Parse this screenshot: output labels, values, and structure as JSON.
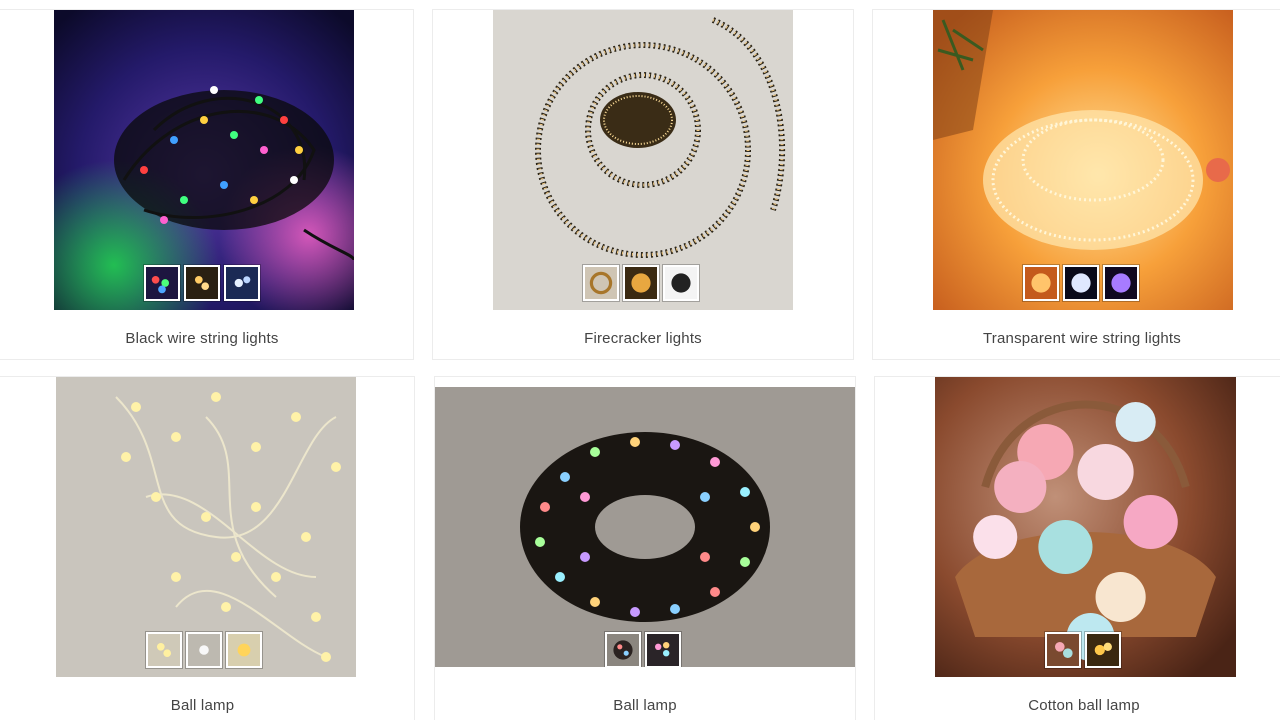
{
  "products": [
    {
      "title": "Black wire string lights",
      "image": "black-wire-string-lights-photo",
      "thumbnails": [
        "multicolor-lights-thumb",
        "warm-lights-thumb",
        "cool-white-lights-thumb"
      ]
    },
    {
      "title": "Firecracker lights",
      "image": "firecracker-lights-photo",
      "thumbnails": [
        "spiral-lights-thumb",
        "warm-cluster-thumb",
        "dark-cluster-thumb"
      ]
    },
    {
      "title": "Transparent wire string lights",
      "image": "transparent-wire-lights-photo",
      "thumbnails": [
        "amber-lights-thumb",
        "white-lights-thumb",
        "purple-lights-thumb"
      ]
    },
    {
      "title": "Ball lamp",
      "image": "yellow-ball-lamp-photo",
      "thumbnails": [
        "yellow-balls-thumb",
        "white-balls-thumb",
        "gold-balls-thumb"
      ]
    },
    {
      "title": "Ball lamp",
      "image": "multicolor-ball-lamp-photo",
      "thumbnails": [
        "rgb-balls-thumb",
        "pastel-balls-thumb"
      ]
    },
    {
      "title": "Cotton ball lamp",
      "image": "cotton-ball-lamp-photo",
      "thumbnails": [
        "pastel-cotton-thumb",
        "yellow-cotton-thumb"
      ]
    }
  ],
  "colors": {
    "border": "#ececec",
    "caption": "#444444"
  }
}
